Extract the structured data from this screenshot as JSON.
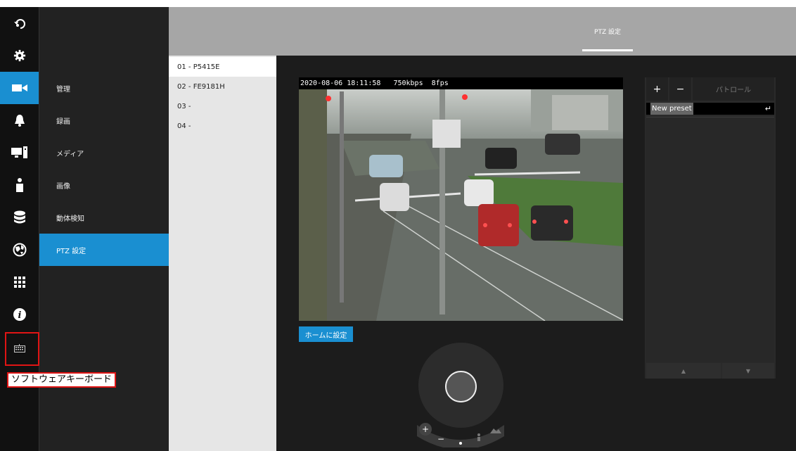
{
  "rail": {
    "icons": [
      "back-icon",
      "gear-icon",
      "camera-icon",
      "bell-icon",
      "monitor-icon",
      "person-icon",
      "database-icon",
      "globe-icon",
      "grid-icon",
      "info-icon",
      "keyboard-icon"
    ]
  },
  "submenu": {
    "items": [
      "管理",
      "録画",
      "メディア",
      "画像",
      "動体検知",
      "PTZ 設定"
    ]
  },
  "header": {
    "tab": "PTZ 設定"
  },
  "cameras": [
    "01 - P5415E",
    "02 - FE9181H",
    "03 -",
    "04 -"
  ],
  "video": {
    "timestamp": "2020-08-06 18:11:58",
    "bitrate": "750kbps",
    "fps": "8fps"
  },
  "home_button": "ホームに設定",
  "preset": {
    "add_label": "+",
    "remove_label": "−",
    "patrol_label": "パトロール",
    "new_preset": "New preset",
    "enter_symbol": "↵",
    "up": "▲",
    "down": "▼"
  },
  "zoom": {
    "in": "+",
    "out": "−"
  },
  "tooltip": "ソフトウェアキーボード",
  "colors": {
    "accent": "#1a8fd1",
    "highlight": "#e01414"
  }
}
